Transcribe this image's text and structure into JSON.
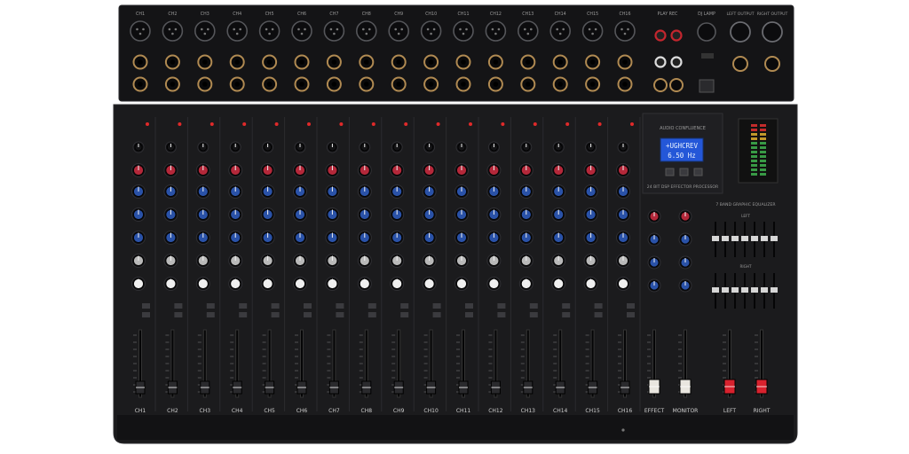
{
  "rear_panel": {
    "channel_labels": [
      "CH1",
      "CH2",
      "CH3",
      "CH4",
      "CH5",
      "CH6",
      "CH7",
      "CH8",
      "CH9",
      "CH10",
      "CH11",
      "CH12",
      "CH13",
      "CH14",
      "CH15",
      "CH16"
    ],
    "play_rec_label": "PLAY  REC",
    "dj_lamp_label": "DJ LAMP",
    "left_output_label": "LEFT OUTPUT",
    "right_output_label": "RIGHT OUTPUT"
  },
  "effects": {
    "brand": "AUDIO CONFLUENCE",
    "lcd_line1": "+UGHCREV",
    "lcd_line2": "6.50 Hz",
    "processor_label": "24 BIT DSP EFFECTOR PROCESSOR"
  },
  "graphic_eq": {
    "title": "7 BAND GRAPHIC EQUALIZER",
    "left_label": "LEFT",
    "right_label": "RIGHT"
  },
  "fader_strip_labels": [
    "CH1",
    "CH2",
    "CH3",
    "CH4",
    "CH5",
    "CH6",
    "CH7",
    "CH8",
    "CH9",
    "CH10",
    "CH11",
    "CH12",
    "CH13",
    "CH14",
    "CH15",
    "CH16",
    "EFFECT",
    "MONITOR",
    "LEFT",
    "RIGHT"
  ],
  "colors": {
    "panel": "#1b1b1d",
    "rear": "#141416",
    "knob_red": "#b4283a",
    "knob_blue": "#2a52a8",
    "lcd": "#2457d8",
    "master_cap": "#d8222e",
    "aux_cap": "#e9e6df"
  }
}
